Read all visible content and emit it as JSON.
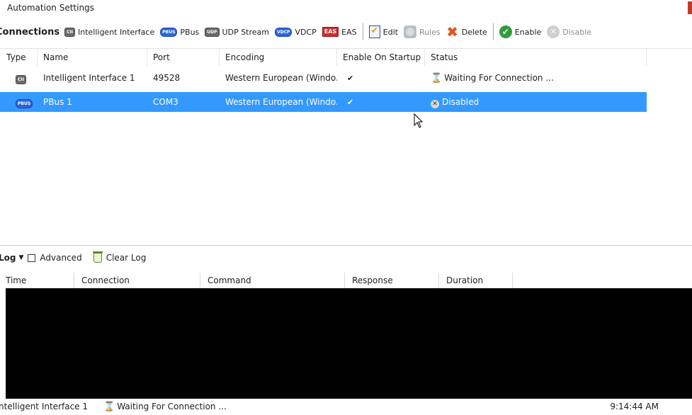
{
  "window": {
    "title": "Automation Settings"
  },
  "toolbar": {
    "connections_label": "Connections",
    "intelligent_interface": {
      "label": "Intelligent Interface",
      "chip": "CII"
    },
    "pbus": {
      "label": "PBus",
      "chip": "PBUS"
    },
    "udp_stream": {
      "label": "UDP Stream",
      "chip": "UDP"
    },
    "vdcp": {
      "label": "VDCP",
      "chip": "VDCP"
    },
    "eas": {
      "label": "EAS",
      "chip": "EAS"
    },
    "edit": {
      "label": "Edit",
      "icon": "edit-checklist-icon"
    },
    "rules": {
      "label": "Rules",
      "icon": "rules-icon"
    },
    "delete": {
      "label": "Delete",
      "icon": "delete-x-icon"
    },
    "enable": {
      "label": "Enable",
      "icon": "checkmark-circle-icon"
    },
    "disable": {
      "label": "Disable",
      "icon": "disable-circle-icon"
    }
  },
  "connections_grid": {
    "columns": [
      "Type",
      "Name",
      "Port",
      "Encoding",
      "Enable On Startup",
      "Status"
    ],
    "rows": [
      {
        "type_chip": "CII",
        "name": "Intelligent Interface 1",
        "port": "49528",
        "encoding": "Western European (Windo...",
        "enable_on_startup": "✔",
        "status": "Waiting For Connection ...",
        "status_icon": "hourglass-icon",
        "selected": false
      },
      {
        "type_chip": "PBUS",
        "name": "PBus 1",
        "port": "COM3",
        "encoding": "Western European (Windo...",
        "enable_on_startup": "✔",
        "status": "Disabled",
        "status_icon": "disabled-x-icon",
        "selected": true
      }
    ]
  },
  "log": {
    "label": "Log",
    "advanced_label": "Advanced",
    "advanced_checked": false,
    "clear_label": "Clear Log",
    "columns": [
      "Time",
      "Connection",
      "Command",
      "Response",
      "Duration"
    ]
  },
  "status_bar": {
    "connection": "ntelligent Interface 1",
    "state": "Waiting For Connection ...",
    "time": "9:14:44 AM"
  },
  "colors": {
    "selection": "#3399ff",
    "chip_blue": "#2c66d6",
    "eas_red": "#d22b2b",
    "enable_green": "#2f9c39",
    "log_background": "#000000"
  }
}
